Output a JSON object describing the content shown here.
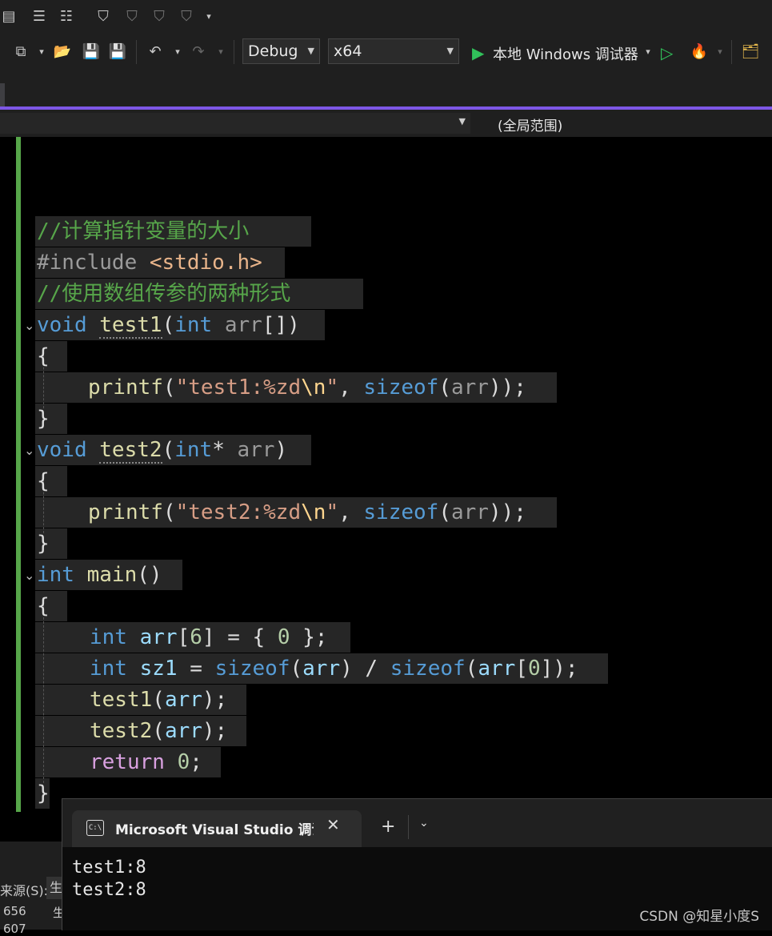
{
  "toolbar": {
    "config": "Debug",
    "platform": "x64",
    "run_label": "本地 Windows 调试器"
  },
  "navbar": {
    "scope": "(全局范围)"
  },
  "code_lines": [
    "//计算指针变量的大小",
    "#include <stdio.h>",
    "//使用数组传参的两种形式",
    "void test1(int arr[])",
    "{",
    "printf(\"test1:%zd\\n\", sizeof(arr));",
    "}",
    "void test2(int* arr)",
    "{",
    "printf(\"test2:%zd\\n\", sizeof(arr));",
    "}",
    "int main()",
    "{",
    "int arr[6] = { 0 };",
    "int sz1 = sizeof(arr) / sizeof(arr[0]);",
    "test1(arr);",
    "test2(arr);",
    "return 0;",
    "}"
  ],
  "output_panel": {
    "source_label": "来源(S):",
    "source_value": "生",
    "row1_num": "656",
    "row1_text": "生",
    "row2_num": "607"
  },
  "terminal": {
    "tab_title": "Microsoft Visual Studio 调试控制台",
    "output": "test1:8\ntest2:8"
  },
  "watermark": "CSDN @知星小度S"
}
